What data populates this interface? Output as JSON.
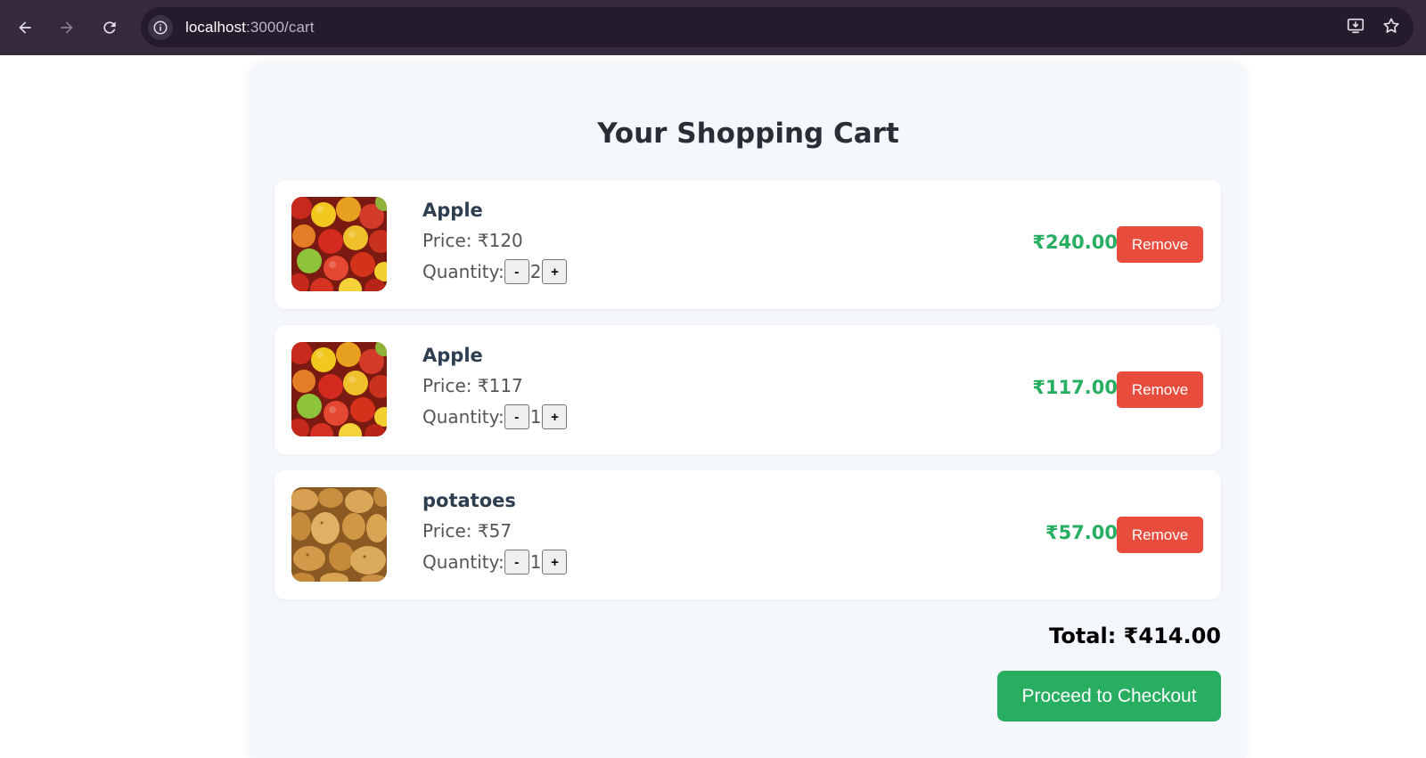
{
  "browser": {
    "url_host": "localhost",
    "url_path": ":3000/cart"
  },
  "page": {
    "title": "Your Shopping Cart"
  },
  "cart": {
    "items": [
      {
        "name": "Apple",
        "price_label": "Price: ₹120",
        "quantity_label": "Quantity:",
        "quantity": "2",
        "line_total": "₹240.00",
        "remove_label": "Remove",
        "minus_label": "-",
        "plus_label": "+",
        "image": "apples-photo"
      },
      {
        "name": "Apple",
        "price_label": "Price: ₹117",
        "quantity_label": "Quantity:",
        "quantity": "1",
        "line_total": "₹117.00",
        "remove_label": "Remove",
        "minus_label": "-",
        "plus_label": "+",
        "image": "apples-photo"
      },
      {
        "name": "potatoes",
        "price_label": "Price: ₹57",
        "quantity_label": "Quantity:",
        "quantity": "1",
        "line_total": "₹57.00",
        "remove_label": "Remove",
        "minus_label": "-",
        "plus_label": "+",
        "image": "potatoes-photo"
      }
    ],
    "total_label": "Total: ₹414.00",
    "checkout_label": "Proceed to Checkout"
  },
  "colors": {
    "accent_green": "#27ae60",
    "remove_red": "#e74c3c",
    "browser_bar": "#35293d"
  }
}
